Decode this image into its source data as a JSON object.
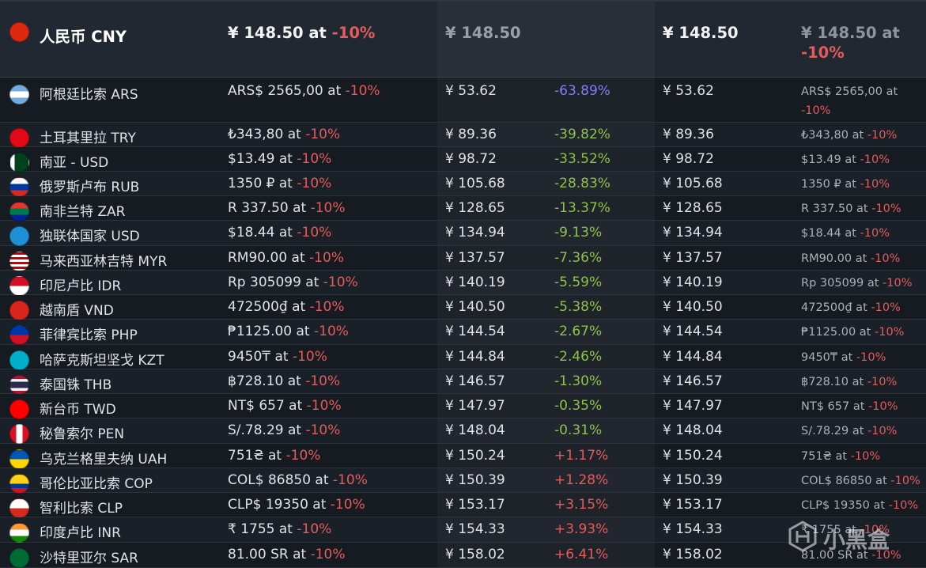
{
  "header": {
    "flag": "cn",
    "name": "人民币 CNY",
    "price": "¥ 148.50 at ",
    "price_discount": "-10%",
    "cny": "¥ 148.50",
    "cny2": "¥ 148.50",
    "small": "¥ 148.50 at ",
    "small_discount": "-10%"
  },
  "rows": [
    {
      "flag": "ar",
      "name": "阿根廷比索 ARS",
      "price": "ARS$ 2565,00 at ",
      "disc": "-10%",
      "cny": "¥ 53.62",
      "pct": "-63.89%",
      "pct_color": "blue",
      "small": "ARS$ 2565,00 at ",
      "small_disc": "-10%"
    },
    {
      "flag": "tr",
      "name": "土耳其里拉 TRY",
      "price": "₺343,80 at ",
      "disc": "-10%",
      "cny": "¥ 89.36",
      "pct": "-39.82%",
      "pct_color": "pos",
      "small": "₺343,80 at ",
      "small_disc": "-10%"
    },
    {
      "flag": "pk",
      "name": "南亚 - USD",
      "price": "$13.49 at ",
      "disc": "-10%",
      "cny": "¥ 98.72",
      "pct": "-33.52%",
      "pct_color": "pos",
      "small": "$13.49 at ",
      "small_disc": "-10%"
    },
    {
      "flag": "ru",
      "name": "俄罗斯卢布 RUB",
      "price": "1350 ₽ at ",
      "disc": "-10%",
      "cny": "¥ 105.68",
      "pct": "-28.83%",
      "pct_color": "pos",
      "small": "1350 ₽ at ",
      "small_disc": "-10%"
    },
    {
      "flag": "za",
      "name": "南非兰特 ZAR",
      "price": "R 337.50 at ",
      "disc": "-10%",
      "cny": "¥ 128.65",
      "pct": "-13.37%",
      "pct_color": "pos",
      "small": "R 337.50 at ",
      "small_disc": "-10%"
    },
    {
      "flag": "cis",
      "name": "独联体国家 USD",
      "price": "$18.44 at ",
      "disc": "-10%",
      "cny": "¥ 134.94",
      "pct": "-9.13%",
      "pct_color": "pos",
      "small": "$18.44 at ",
      "small_disc": "-10%"
    },
    {
      "flag": "my",
      "name": "马来西亚林吉特 MYR",
      "price": "RM90.00 at ",
      "disc": "-10%",
      "cny": "¥ 137.57",
      "pct": "-7.36%",
      "pct_color": "pos",
      "small": "RM90.00 at ",
      "small_disc": "-10%"
    },
    {
      "flag": "id",
      "name": "印尼卢比 IDR",
      "price": "Rp 305099 at ",
      "disc": "-10%",
      "cny": "¥ 140.19",
      "pct": "-5.59%",
      "pct_color": "pos",
      "small": "Rp 305099 at ",
      "small_disc": "-10%"
    },
    {
      "flag": "vn",
      "name": "越南盾 VND",
      "price": "472500₫ at ",
      "disc": "-10%",
      "cny": "¥ 140.50",
      "pct": "-5.38%",
      "pct_color": "pos",
      "small": "472500₫ at ",
      "small_disc": "-10%"
    },
    {
      "flag": "ph",
      "name": "菲律宾比索 PHP",
      "price": "₱1125.00 at ",
      "disc": "-10%",
      "cny": "¥ 144.54",
      "pct": "-2.67%",
      "pct_color": "pos",
      "small": "₱1125.00 at ",
      "small_disc": "-10%"
    },
    {
      "flag": "kz",
      "name": "哈萨克斯坦坚戈 KZT",
      "price": "9450₸ at ",
      "disc": "-10%",
      "cny": "¥ 144.84",
      "pct": "-2.46%",
      "pct_color": "pos",
      "small": "9450₸ at ",
      "small_disc": "-10%"
    },
    {
      "flag": "th",
      "name": "泰国铢 THB",
      "price": "฿728.10 at ",
      "disc": "-10%",
      "cny": "¥ 146.57",
      "pct": "-1.30%",
      "pct_color": "pos",
      "small": "฿728.10 at ",
      "small_disc": "-10%"
    },
    {
      "flag": "tw",
      "name": "新台币 TWD",
      "price": "NT$ 657 at ",
      "disc": "-10%",
      "cny": "¥ 147.97",
      "pct": "-0.35%",
      "pct_color": "pos",
      "small": "NT$ 657 at ",
      "small_disc": "-10%"
    },
    {
      "flag": "pe",
      "name": "秘鲁索尔 PEN",
      "price": "S/.78.29 at ",
      "disc": "-10%",
      "cny": "¥ 148.04",
      "pct": "-0.31%",
      "pct_color": "pos",
      "small": "S/.78.29 at ",
      "small_disc": "-10%"
    },
    {
      "flag": "ua",
      "name": "乌克兰格里夫纳 UAH",
      "price": "751₴ at ",
      "disc": "-10%",
      "cny": "¥ 150.24",
      "pct": "+1.17%",
      "pct_color": "red",
      "small": "751₴ at ",
      "small_disc": "-10%"
    },
    {
      "flag": "co",
      "name": "哥伦比亚比索 COP",
      "price": "COL$ 86850 at ",
      "disc": "-10%",
      "cny": "¥ 150.39",
      "pct": "+1.28%",
      "pct_color": "red",
      "small": "COL$ 86850 at ",
      "small_disc": "-10%"
    },
    {
      "flag": "cl",
      "name": "智利比索 CLP",
      "price": "CLP$ 19350 at ",
      "disc": "-10%",
      "cny": "¥ 153.17",
      "pct": "+3.15%",
      "pct_color": "red",
      "small": "CLP$ 19350 at ",
      "small_disc": "-10%"
    },
    {
      "flag": "in",
      "name": "印度卢比 INR",
      "price": "₹ 1755 at ",
      "disc": "-10%",
      "cny": "¥ 154.33",
      "pct": "+3.93%",
      "pct_color": "red",
      "small": "₹ 1755 at ",
      "small_disc": "-10%"
    },
    {
      "flag": "sa",
      "name": "沙特里亚尔 SAR",
      "price": "81.00 SR at ",
      "disc": "-10%",
      "cny": "¥ 158.02",
      "pct": "+6.41%",
      "pct_color": "red",
      "small": "81.00 SR at ",
      "small_disc": "-10%"
    }
  ],
  "watermark": {
    "text": "小黑盒",
    "icon": "heybox-logo-icon"
  }
}
